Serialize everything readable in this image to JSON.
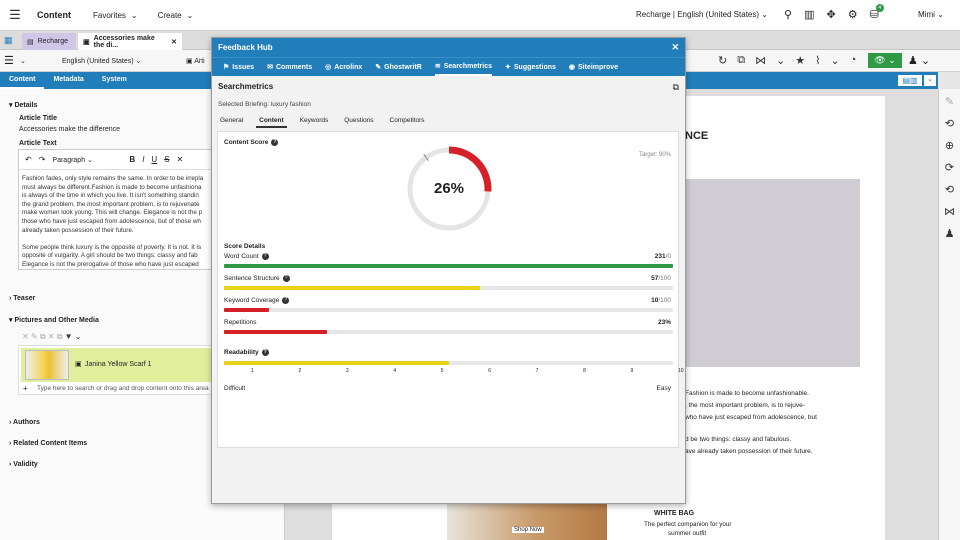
{
  "topbar": {
    "brand": "Content",
    "menus": [
      "Favorites",
      "Create"
    ],
    "site": "Recharge | English (United States)",
    "user": "Mimi",
    "badge": "4"
  },
  "tabs": [
    {
      "label": "Recharge"
    },
    {
      "label": "Accessories make the di..."
    }
  ],
  "toolbar": {
    "locale": "English (United States)",
    "arti": "Arti"
  },
  "subtabs": [
    "Content",
    "Metadata",
    "System"
  ],
  "left": {
    "details": "Details",
    "article_title_label": "Article Title",
    "article_title_value": "Accessories make the difference",
    "article_text_label": "Article Text",
    "paragraph": "Paragraph",
    "text": "Fashion fades, only style remains the same. In order to be irrepla\nmust always be different.Fashion is made to become unfashiona\nis always of the time in which you live. It isn't something standin\nthe grand problem, the most important problem, is to rejuvenate\nmake women look young. This will change. Elegance is not the p\nthose who have just escaped from adolescence, but of those wh\nalready taken possession of their future.\n\nSome people think luxury is the opposite of poverty. It is not. It is\nopposite of vulgarity. A girl should be two things: classy and fab\nElegance is not the prerogative of those who have just escaped\nadolescence, but of those who have already taken possession o",
    "teaser": "Teaser",
    "pictures": "Pictures and Other Media",
    "media_item": "Janina Yellow Scarf 1",
    "media_placeholder": "Type here to search or drag and drop content onto this area",
    "authors": "Authors",
    "related": "Related Content Items",
    "validity": "Validity"
  },
  "preview": {
    "heading_fragment": "NCE",
    "p1": "Fashion is made to become unfashionable.",
    "p2": ", the most important problem, is to rejuve-",
    "p3": "who have just escaped from adolescence, but",
    "p4": "d be two things: classy and fabulous.",
    "p5": "ave already taken possession of their future.",
    "shop": "Shop Now",
    "white_bag": "WHITE BAG",
    "wb1": "The perfect companion for your",
    "wb2": "summer outfit"
  },
  "feedback": {
    "title": "Feedback Hub",
    "tabs": [
      "Issues",
      "Comments",
      "Acrolinx",
      "GhostwritR",
      "Searchmetrics",
      "Suggestions",
      "Siteimprove"
    ],
    "active_tab": "Searchmetrics",
    "panel_title": "Searchmetrics",
    "briefing": "Selected Briefing: luxury fashion",
    "inner_tabs": [
      "General",
      "Content",
      "Keywords",
      "Questions",
      "Competitors"
    ],
    "content_score_label": "Content Score",
    "target": "Target: 90%",
    "score_text": "26%",
    "score_value": 0.26,
    "target_value": 0.9,
    "score_details": "Score Details",
    "metrics": [
      {
        "label": "Word Count",
        "value": "231",
        "denom": "/0",
        "fraction": 1.0,
        "color": "#2e9a46"
      },
      {
        "label": "Sentence Structure",
        "value": "57",
        "denom": "/100",
        "fraction": 0.57,
        "color": "#e8d114"
      },
      {
        "label": "Keyword Coverage",
        "value": "10",
        "denom": "/100",
        "fraction": 0.1,
        "color": "#d62027"
      },
      {
        "label": "Repetitions",
        "value": "23%",
        "denom": "",
        "fraction": 0.23,
        "color": "#d62027"
      }
    ],
    "readability_label": "Readability",
    "readability_fraction": 0.5,
    "readability_ticks": [
      "1",
      "2",
      "3",
      "4",
      "5",
      "6",
      "7",
      "8",
      "9",
      "10"
    ],
    "difficult": "Difficult",
    "easy": "Easy",
    "colors": {
      "accent": "#227eba",
      "red": "#d62027",
      "yellow": "#e8d114",
      "green": "#2e9a46"
    }
  }
}
